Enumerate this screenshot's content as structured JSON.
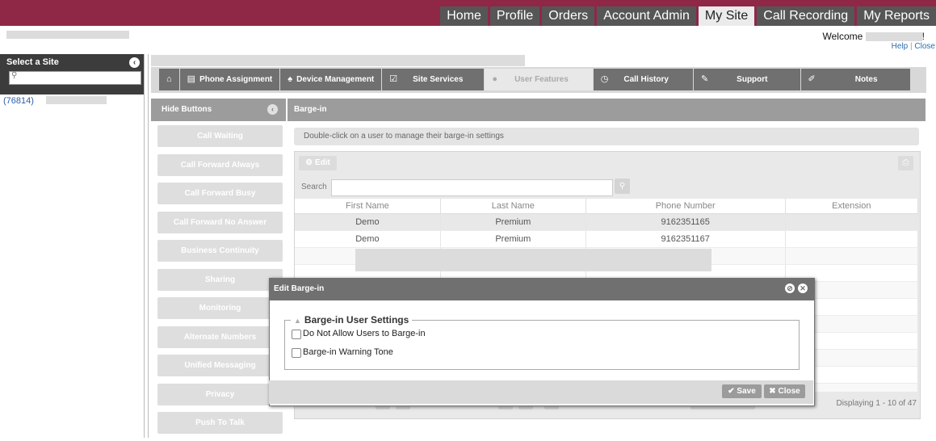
{
  "nav": {
    "items": [
      {
        "label": "Home"
      },
      {
        "label": "Profile"
      },
      {
        "label": "Orders"
      },
      {
        "label": "Account Admin"
      },
      {
        "label": "My Site"
      },
      {
        "label": "Call Recording"
      },
      {
        "label": "My Reports"
      }
    ],
    "active": "My Site"
  },
  "header": {
    "welcome": "Welcome",
    "welcome_suffix": "!",
    "help": "Help",
    "close": "Close"
  },
  "site_panel": {
    "title": "Select a Site",
    "site_id": "(76814)"
  },
  "tabs": [
    {
      "label": "",
      "icon": "home-icon"
    },
    {
      "label": "Phone Assignment",
      "icon": "phone-icon"
    },
    {
      "label": "Device Management",
      "icon": "bell-icon"
    },
    {
      "label": "Site Services",
      "icon": "checkbox-icon"
    },
    {
      "label": "User Features",
      "icon": "user-icon"
    },
    {
      "label": "Call History",
      "icon": "clock-icon"
    },
    {
      "label": "Support",
      "icon": "wrench-icon"
    },
    {
      "label": "Notes",
      "icon": "pencil-icon"
    }
  ],
  "active_tab": "User Features",
  "sidebar": {
    "hide_label": "Hide Buttons",
    "buttons": [
      "Call Waiting",
      "Call Forward Always",
      "Call Forward Busy",
      "Call Forward No Answer",
      "Business Continuity",
      "Sharing",
      "Monitoring",
      "Alternate Numbers",
      "Unified Messaging",
      "Privacy",
      "Push To Talk"
    ]
  },
  "content": {
    "title": "Barge-in",
    "hint": "Double-click on a user to manage their barge-in settings",
    "edit_label": "Edit",
    "search_label": "Search",
    "columns": [
      "First Name",
      "Last Name",
      "Phone Number",
      "Extension"
    ],
    "rows": [
      [
        "Demo",
        "Premium",
        "9162351165",
        ""
      ],
      [
        "Demo",
        "Premium",
        "9162351167",
        ""
      ]
    ],
    "displaying": "Displaying 1 - 10 of 47"
  },
  "modal": {
    "title": "Edit Barge-in",
    "legend": "Barge-in User Settings",
    "options": [
      {
        "label": "Do Not Allow Users to Barge-in",
        "checked": false
      },
      {
        "label": "Barge-in Warning Tone",
        "checked": false
      }
    ],
    "save_label": "Save",
    "close_label": "Close"
  },
  "colors": {
    "brand": "#8e2846",
    "nav_bg": "#565656",
    "tab_bg": "#707070",
    "link": "#2a5ea8"
  }
}
